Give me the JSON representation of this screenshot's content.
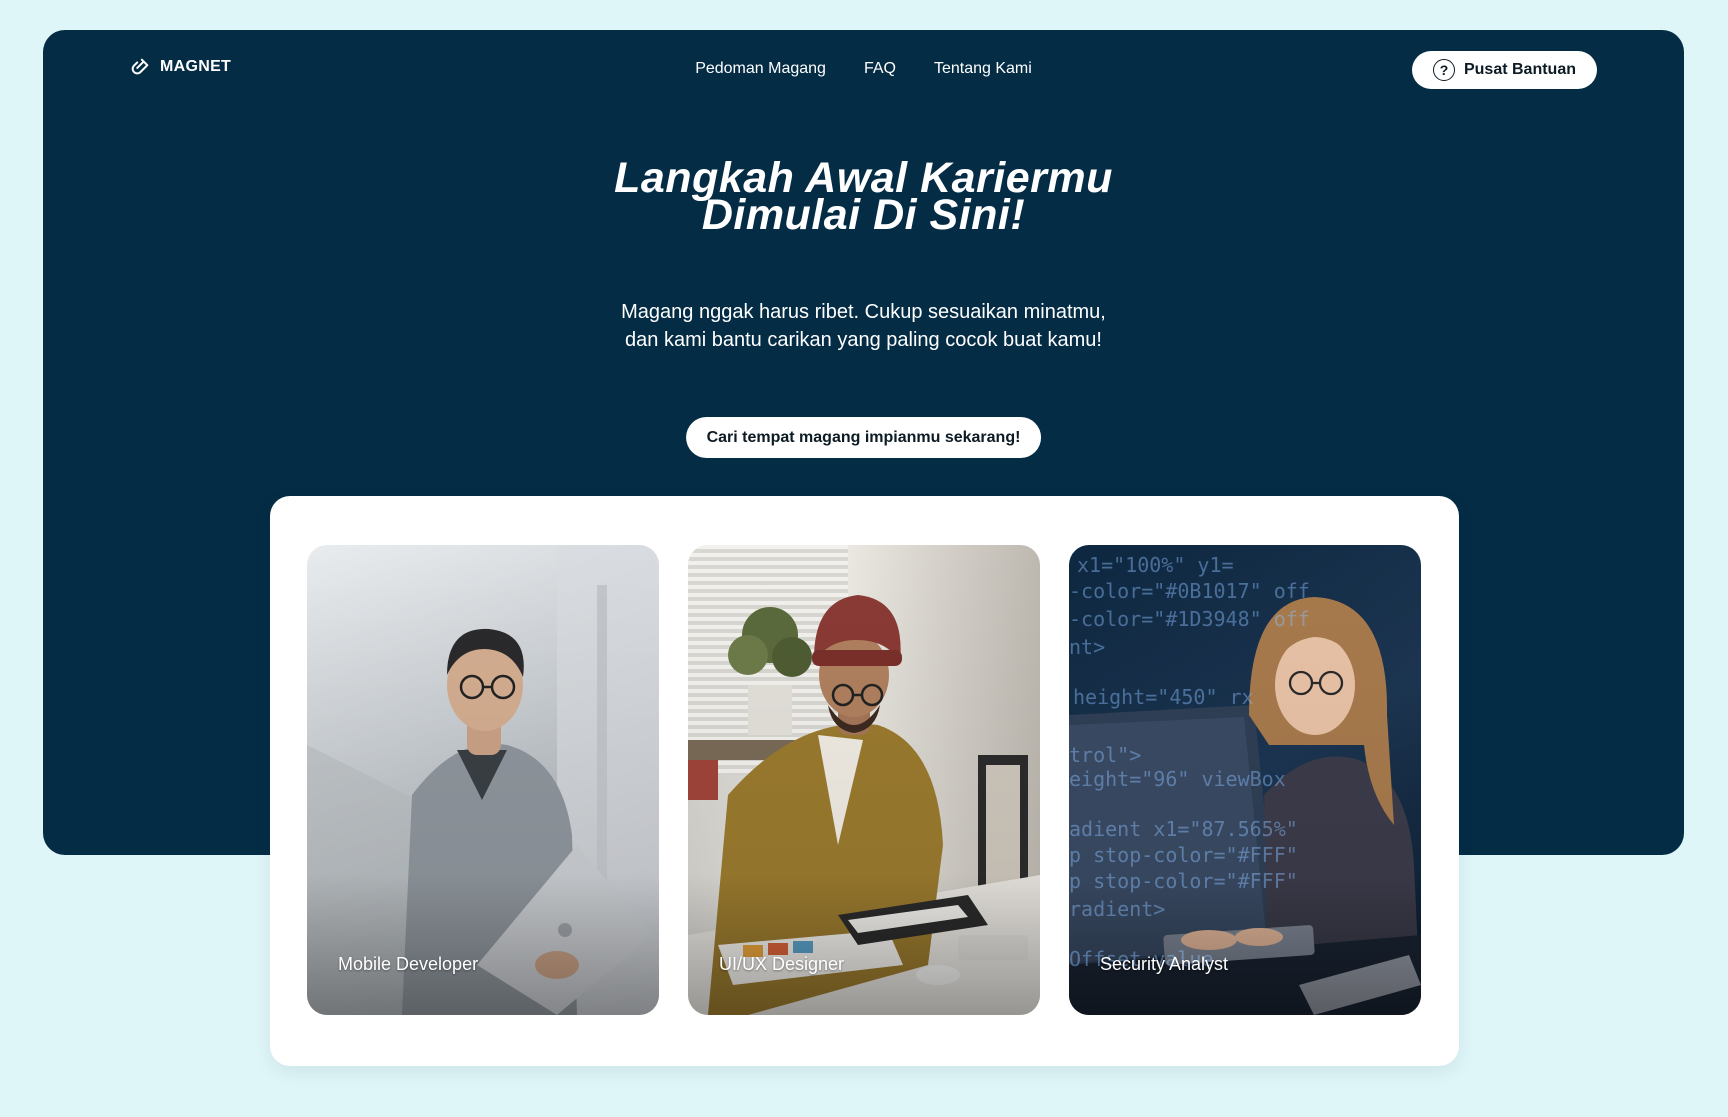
{
  "nav": {
    "brand": "MAGNET",
    "links": [
      "Pedoman Magang",
      "FAQ",
      "Tentang Kami"
    ],
    "help_label": "Pusat Bantuan"
  },
  "hero": {
    "title_line1": "Langkah Awal Kariermu",
    "title_line2": "Dimulai Di Sini!",
    "subtitle": "Magang nggak harus ribet. Cukup sesuaikan minatmu, dan kami bantu carikan yang paling cocok buat kamu!",
    "cta_label": "Cari tempat magang impianmu sekarang!"
  },
  "cards": [
    {
      "label": "Mobile Developer"
    },
    {
      "label": "UI/UX Designer"
    },
    {
      "label": "Security Analyst"
    }
  ],
  "colors": {
    "page_bg": "#dff6f8",
    "hero_bg": "#042c45",
    "panel_bg": "#ffffff",
    "text_light": "#ffffff",
    "text_dark": "#0d1b24"
  }
}
